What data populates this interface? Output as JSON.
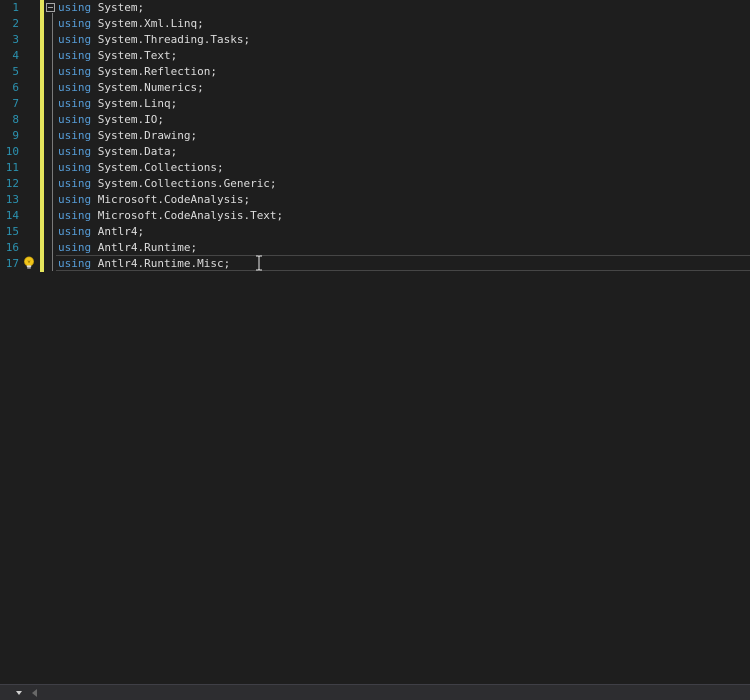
{
  "editor": {
    "keyword": "using",
    "lines": [
      {
        "number": "1",
        "code": " System;"
      },
      {
        "number": "2",
        "code": " System.Xml.Linq;"
      },
      {
        "number": "3",
        "code": " System.Threading.Tasks;"
      },
      {
        "number": "4",
        "code": " System.Text;"
      },
      {
        "number": "5",
        "code": " System.Reflection;"
      },
      {
        "number": "6",
        "code": " System.Numerics;"
      },
      {
        "number": "7",
        "code": " System.Linq;"
      },
      {
        "number": "8",
        "code": " System.IO;"
      },
      {
        "number": "9",
        "code": " System.Drawing;"
      },
      {
        "number": "10",
        "code": " System.Data;"
      },
      {
        "number": "11",
        "code": " System.Collections;"
      },
      {
        "number": "12",
        "code": " System.Collections.Generic;"
      },
      {
        "number": "13",
        "code": " Microsoft.CodeAnalysis;"
      },
      {
        "number": "14",
        "code": " Microsoft.CodeAnalysis.Text;"
      },
      {
        "number": "15",
        "code": " Antlr4;"
      },
      {
        "number": "16",
        "code": " Antlr4.Runtime;"
      },
      {
        "number": "17",
        "code": " Antlr4.Runtime.Misc;"
      }
    ]
  },
  "colors": {
    "background": "#1e1e1e",
    "line_number": "#2b91af",
    "keyword": "#569cd6",
    "text": "#dcdcdc",
    "change_bar": "#e5e55c"
  },
  "icons": {
    "fold": "collapse-minus-icon",
    "lightbulb": "lightbulb-icon",
    "cursor": "text-cursor-icon",
    "zoom": "chevron-down-icon",
    "scroll_left": "arrow-left-icon"
  }
}
